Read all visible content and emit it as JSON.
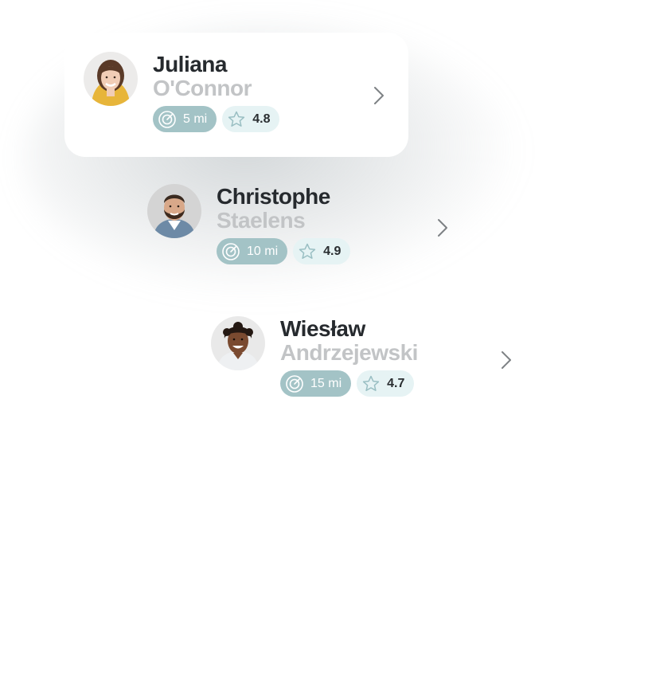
{
  "people": [
    {
      "first_name": "Juliana",
      "last_name": "O'Connor",
      "distance": "5 mi",
      "rating": "4.8",
      "selected": true
    },
    {
      "first_name": "Christophe",
      "last_name": "Staelens",
      "distance": "10 mi",
      "rating": "4.9",
      "selected": false
    },
    {
      "first_name": "Wiesław",
      "last_name": "Andrzejewski",
      "distance": "15 mi",
      "rating": "4.7",
      "selected": false
    }
  ],
  "icons": {
    "distance": "target-icon",
    "rating": "star-icon",
    "open": "chevron-right-icon"
  },
  "colors": {
    "distance_badge": "#a3c3c6",
    "rating_badge": "#e6f3f4",
    "name": "#262a2e",
    "surname": "#c2c4c6",
    "chevron": "#7d8184"
  }
}
